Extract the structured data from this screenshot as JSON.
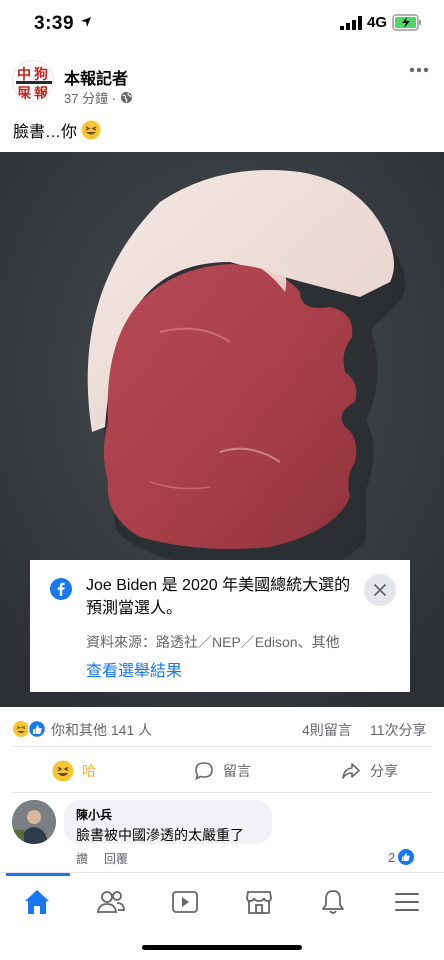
{
  "status_bar": {
    "time": "3:39",
    "network": "4G"
  },
  "post": {
    "page_name": "本報記者",
    "time_ago": "37 分鐘 ·",
    "text": "臉書…你",
    "icons": {
      "logo": "newspaper-logo",
      "privacy": "globe-icon",
      "more": "more-options-icon",
      "emoji": "laughing-emoji"
    }
  },
  "link_card": {
    "headline": "Joe Biden 是 2020 年美國總統大選的預測當選人。",
    "source": "資料來源：路透社／NEP／Edison、其他",
    "link": "查看選舉結果",
    "icons": {
      "brand": "facebook-icon",
      "close": "close-icon"
    }
  },
  "reactions": {
    "summary": "你和其他 141 人",
    "comments": "4則留言",
    "shares": "11次分享"
  },
  "actions": {
    "haha": "哈",
    "comment": "留言",
    "share": "分享"
  },
  "comment": {
    "author": "陳小兵",
    "text": "臉書被中國滲透的太嚴重了",
    "reply_read": "讚",
    "reply": "回覆",
    "likes": "2"
  },
  "colors": {
    "facebook_blue": "#1877f2",
    "haha_yellow": "#f7b125",
    "meta_gray": "#65676b"
  },
  "bottom_nav": {
    "items": [
      "home-icon",
      "friends-icon",
      "watch-icon",
      "marketplace-icon",
      "notifications-icon",
      "menu-icon"
    ]
  }
}
